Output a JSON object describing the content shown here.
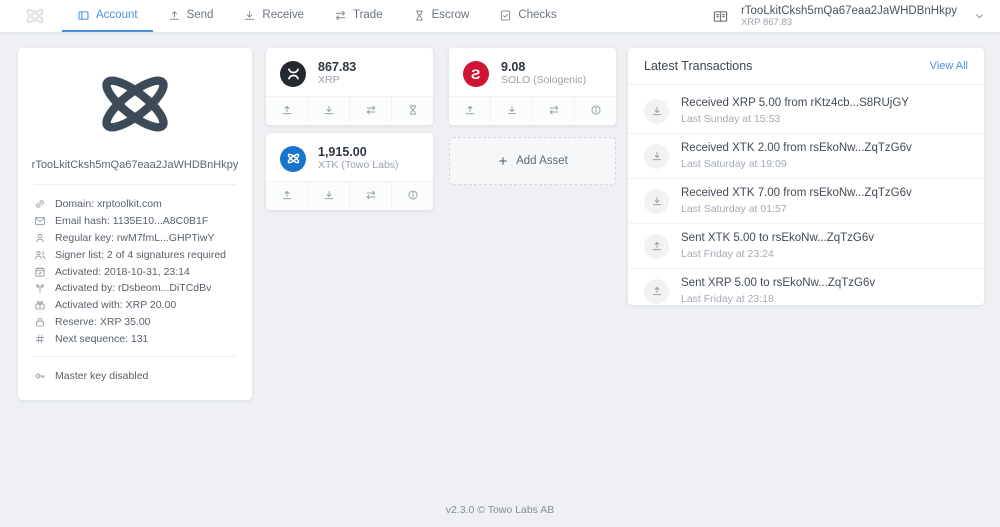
{
  "colors": {
    "accent": "#4a90e2",
    "xrp_black": "#23292f",
    "solo_red": "#cf1434",
    "xtk_blue": "#1875cc",
    "logo_slate": "#3d4a57"
  },
  "icons": {
    "plus": "+"
  },
  "header": {
    "tabs": [
      {
        "label": "Account",
        "icon": "account-icon",
        "active": true
      },
      {
        "label": "Send",
        "icon": "send-icon"
      },
      {
        "label": "Receive",
        "icon": "receive-icon"
      },
      {
        "label": "Trade",
        "icon": "trade-icon"
      },
      {
        "label": "Escrow",
        "icon": "escrow-icon"
      },
      {
        "label": "Checks",
        "icon": "checks-icon"
      }
    ],
    "account_selector": {
      "address": "rTooLkitCksh5mQa67eaa2JaWHDBnHkpy",
      "balance": "XRP 867.83"
    }
  },
  "account_card": {
    "address": "rTooLkitCksh5mQa67eaa2JaWHDBnHkpy",
    "details": [
      {
        "icon": "link-icon",
        "text": "Domain: xrptoolkit.com"
      },
      {
        "icon": "mail-icon",
        "text": "Email hash: 1135E10...A8C0B1F"
      },
      {
        "icon": "person-icon",
        "text": "Regular key: rwM7fmL...GHPTiwY"
      },
      {
        "icon": "signers-icon",
        "text": "Signer list: 2 of 4 signatures required"
      },
      {
        "icon": "calendar-icon",
        "text": "Activated: 2018-10-31, 23:14"
      },
      {
        "icon": "branch-icon",
        "text": "Activated by: rDsbeom...DiTCdBv"
      },
      {
        "icon": "gift-icon",
        "text": "Activated with: XRP 20.00"
      },
      {
        "icon": "lock-icon",
        "text": "Reserve: XRP 35.00"
      },
      {
        "icon": "hash-icon",
        "text": "Next sequence: 131"
      }
    ],
    "master_key": "Master key disabled"
  },
  "assets": [
    {
      "amount": "867.83",
      "name": "XRP",
      "logo": "xrp-logo"
    },
    {
      "amount": "9.08",
      "name": "SOLO (Sologenic)",
      "logo": "sologenic-logo",
      "logo_letter": "S"
    },
    {
      "amount": "1,915.00",
      "name": "XTK (Towo Labs)",
      "logo": "xtk-logo"
    }
  ],
  "add_asset": {
    "label": "Add Asset"
  },
  "transactions": {
    "title": "Latest Transactions",
    "view_all": "View All",
    "items": [
      {
        "direction": "received",
        "text": "Received XRP 5.00 from rKtz4cb...S8RUjGY",
        "time": "Last Sunday at 15:53"
      },
      {
        "direction": "received",
        "text": "Received XTK 2.00 from rsEkoNw...ZqTzG6v",
        "time": "Last Saturday at 19:09"
      },
      {
        "direction": "received",
        "text": "Received XTK 7.00 from rsEkoNw...ZqTzG6v",
        "time": "Last Saturday at 01:57"
      },
      {
        "direction": "sent",
        "text": "Sent XTK 5.00 to rsEkoNw...ZqTzG6v",
        "time": "Last Friday at 23:24"
      },
      {
        "direction": "sent",
        "text": "Sent XRP 5.00 to rsEkoNw...ZqTzG6v",
        "time": "Last Friday at 23:18"
      }
    ]
  },
  "footer": {
    "version": "v2.3.0 © Towo Labs AB"
  }
}
